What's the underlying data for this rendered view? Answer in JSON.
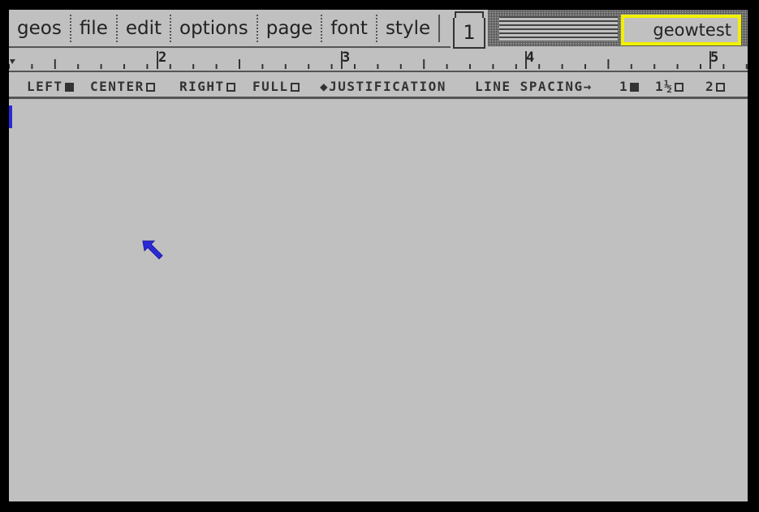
{
  "menu": {
    "items": [
      "geos",
      "file",
      "edit",
      "options",
      "page",
      "font",
      "style"
    ]
  },
  "page_indicator": {
    "number": "1"
  },
  "document": {
    "title": "geowtest"
  },
  "ruler": {
    "labels": [
      "2",
      "3",
      "4",
      "5"
    ]
  },
  "formatbar": {
    "left": "LEFT",
    "center": "CENTER",
    "right": "RIGHT",
    "full": "FULL",
    "justification": "JUSTIFICATION",
    "line_spacing": "LINE SPACING",
    "spacing_1": "1",
    "spacing_1_5": "1½",
    "spacing_2": "2",
    "selected_justification": "left",
    "selected_spacing": "1"
  },
  "colors": {
    "screen_bg": "#c0c0c0",
    "border": "#000000",
    "title_highlight": "#f0f000",
    "cursor": "#2a2ad8"
  },
  "icons": [
    "arrow-left-icon",
    "arrow-right-icon",
    "mouse-pointer-icon",
    "text-cursor"
  ]
}
